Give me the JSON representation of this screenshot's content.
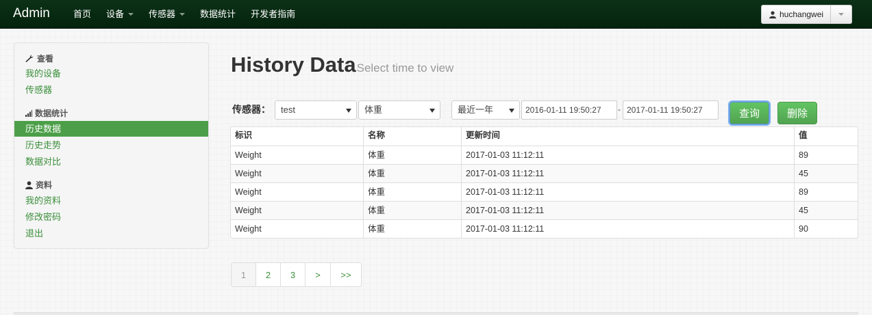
{
  "brand": "Admin",
  "nav": {
    "items": [
      {
        "label": "首页"
      },
      {
        "label": "设备"
      },
      {
        "label": "传感器"
      },
      {
        "label": "数据统计"
      },
      {
        "label": "开发者指南"
      }
    ]
  },
  "user": {
    "name": "huchangwei"
  },
  "sidebar": {
    "sections": [
      {
        "header": "查看",
        "icon": "wrench-icon",
        "items": [
          "我的设备",
          "传感器"
        ]
      },
      {
        "header": "数据统计",
        "icon": "bar-chart-icon",
        "items": [
          "历史数据",
          "历史走势",
          "数据对比"
        ]
      },
      {
        "header": "资料",
        "icon": "user-icon",
        "items": [
          "我的资料",
          "修改密码",
          "退出"
        ]
      }
    ],
    "active_item": "历史数据"
  },
  "page": {
    "title": "History Data",
    "subtitle": "Select time to view"
  },
  "filter": {
    "label": "传感器：",
    "device_select": "test",
    "sensor_select": "体重",
    "range_select": "最近一年",
    "start_time": "2016-01-11 19:50:27",
    "separator": "-",
    "end_time": "2017-01-11 19:50:27",
    "query_button": "查询",
    "delete_button": "删除"
  },
  "table": {
    "columns": [
      "标识",
      "名称",
      "更新时间",
      "值"
    ],
    "rows": [
      [
        "Weight",
        "体重",
        "2017-01-03 11:12:11",
        "89"
      ],
      [
        "Weight",
        "体重",
        "2017-01-03 11:12:11",
        "45"
      ],
      [
        "Weight",
        "体重",
        "2017-01-03 11:12:11",
        "89"
      ],
      [
        "Weight",
        "体重",
        "2017-01-03 11:12:11",
        "45"
      ],
      [
        "Weight",
        "体重",
        "2017-01-03 11:12:11",
        "90"
      ]
    ]
  },
  "pagination": {
    "pages": [
      "1",
      "2",
      "3",
      ">",
      ">>"
    ],
    "active": "1"
  },
  "colors": {
    "navbar": "#04230d",
    "accent": "#4c9f48",
    "link": "#3b8f3b"
  }
}
